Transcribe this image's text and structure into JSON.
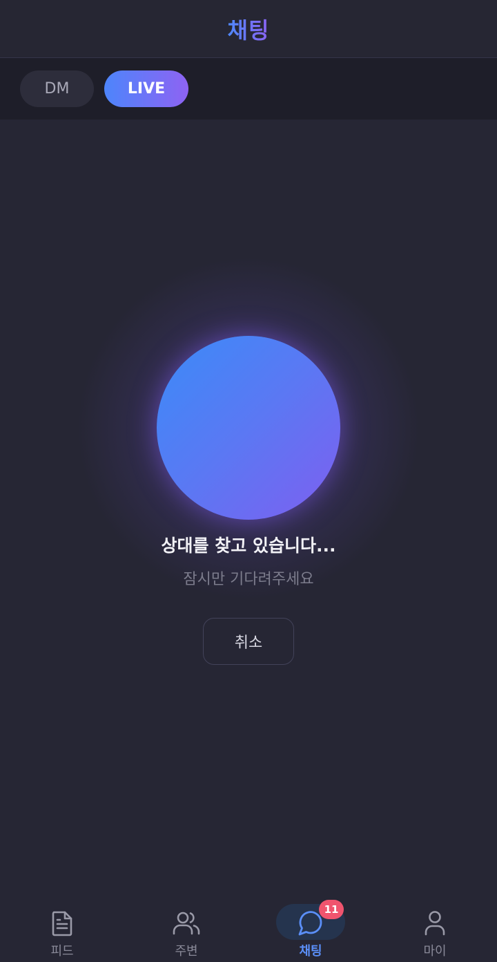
{
  "header": {
    "title": "채팅"
  },
  "tabs": [
    {
      "label": "DM",
      "active": false
    },
    {
      "label": "LIVE",
      "active": true
    }
  ],
  "matching": {
    "title": "상대를 찾고 있습니다...",
    "subtitle": "잠시만 기다려주세요",
    "cancel_label": "취소"
  },
  "nav": {
    "items": [
      {
        "label": "피드",
        "icon": "document-icon",
        "active": false
      },
      {
        "label": "주변",
        "icon": "users-icon",
        "active": false
      },
      {
        "label": "채팅",
        "icon": "chat-bubble-icon",
        "active": true,
        "badge": "11"
      },
      {
        "label": "마이",
        "icon": "user-icon",
        "active": false
      }
    ]
  },
  "colors": {
    "accent_blue": "#4d85fb",
    "accent_purple": "#8e63f3",
    "badge_red": "#f0546e",
    "background": "#262634"
  }
}
